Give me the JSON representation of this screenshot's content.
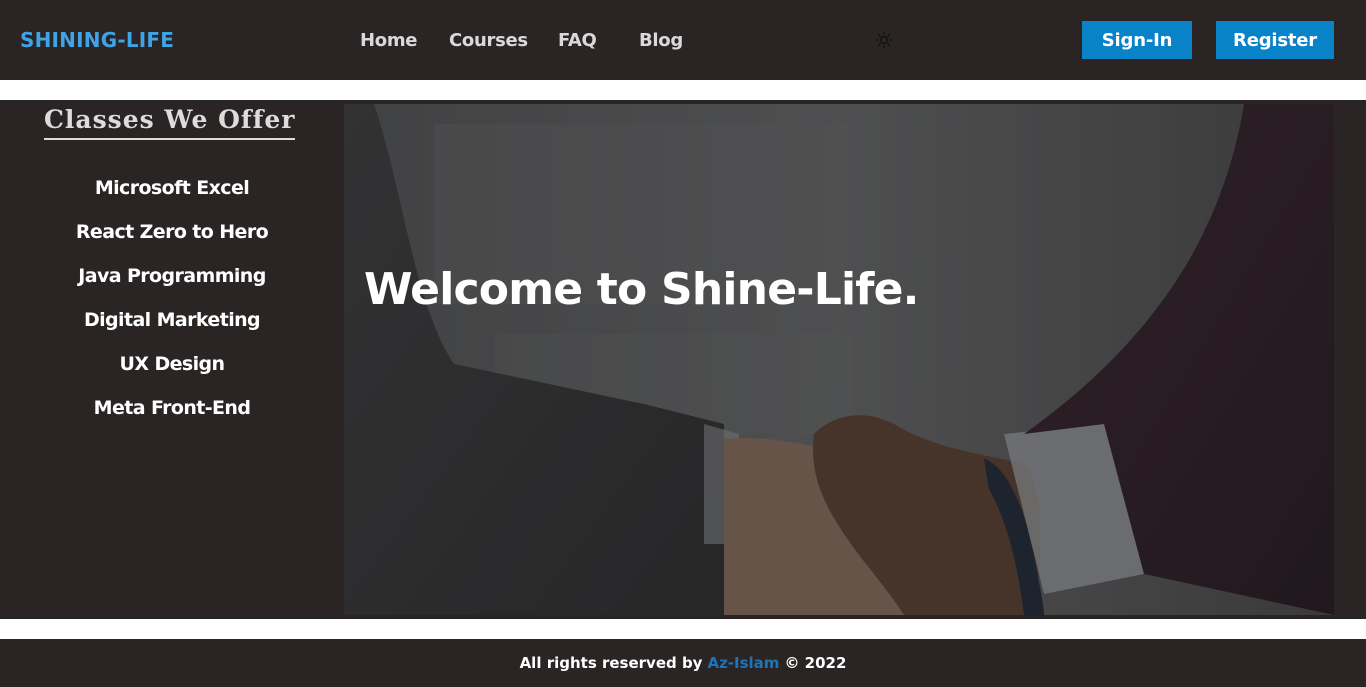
{
  "header": {
    "brand": "SHINING-LIFE",
    "nav": [
      {
        "label": "Home"
      },
      {
        "label": "Courses"
      },
      {
        "label": "FAQ"
      },
      {
        "label": "Blog"
      }
    ],
    "theme_toggle_icon": "sun-icon",
    "signin_label": "Sign-In",
    "register_label": "Register"
  },
  "sidebar": {
    "title": "Classes We Offer",
    "classes": [
      {
        "label": "Microsoft Excel"
      },
      {
        "label": "React Zero to Hero"
      },
      {
        "label": "Java Programming"
      },
      {
        "label": "Digital Marketing"
      },
      {
        "label": "UX Design"
      },
      {
        "label": "Meta Front-End"
      }
    ]
  },
  "hero": {
    "title": "Welcome to Shine-Life."
  },
  "footer": {
    "prefix": "All rights reserved by",
    "author": "Az-Islam",
    "suffix": "© 2022"
  },
  "colors": {
    "background_dark": "#2a2524",
    "brand": "#3ea4e6",
    "button": "#0a82c8",
    "footer_link": "#1f74b8"
  }
}
